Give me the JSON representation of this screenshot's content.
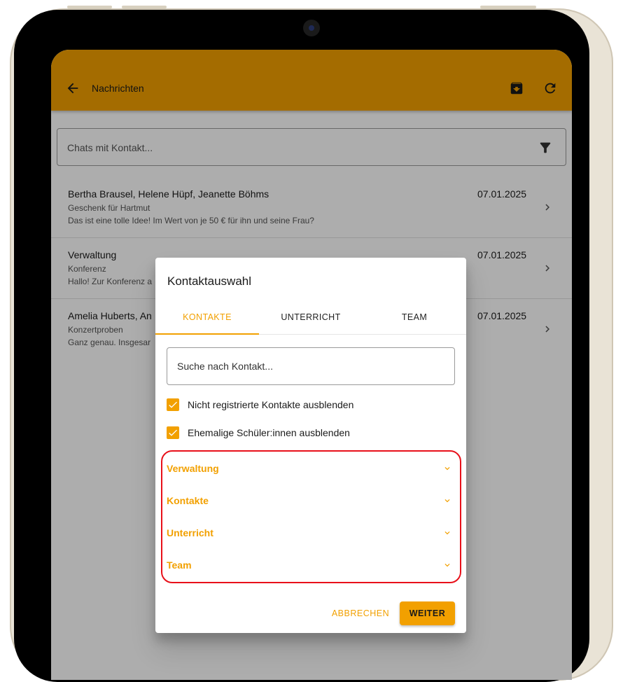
{
  "appbar": {
    "title": "Nachrichten"
  },
  "chat_search": {
    "placeholder": "Chats mit Kontakt..."
  },
  "chats": [
    {
      "name": "Bertha Brausel, Helene Hüpf, Jeanette Böhms",
      "subject": "Geschenk für Hartmut",
      "preview": "Das ist eine tolle Idee! Im Wert von je 50 € für ihn und seine Frau?",
      "date": "07.01.2025"
    },
    {
      "name": "Verwaltung",
      "subject": "Konferenz",
      "preview": "Hallo! Zur Konferenz a",
      "date": "07.01.2025"
    },
    {
      "name": "Amelia Huberts, An",
      "subject": "Konzertproben",
      "preview": "Ganz genau. Insgesar",
      "date": "07.01.2025"
    }
  ],
  "dialog": {
    "title": "Kontaktauswahl",
    "tabs": [
      "KONTAKTE",
      "UNTERRICHT",
      "TEAM"
    ],
    "active_tab": "KONTAKTE",
    "search_placeholder": "Suche nach Kontakt...",
    "options": [
      {
        "label": "Nicht registrierte Kontakte ausblenden",
        "checked": true
      },
      {
        "label": "Ehemalige Schüler:innen ausblenden",
        "checked": true
      }
    ],
    "groups": [
      "Verwaltung",
      "Kontakte",
      "Unterricht",
      "Team"
    ],
    "cancel_label": "ABBRECHEN",
    "next_label": "WEITER"
  },
  "colors": {
    "accent": "#f2a000",
    "highlight": "#e8101a"
  }
}
